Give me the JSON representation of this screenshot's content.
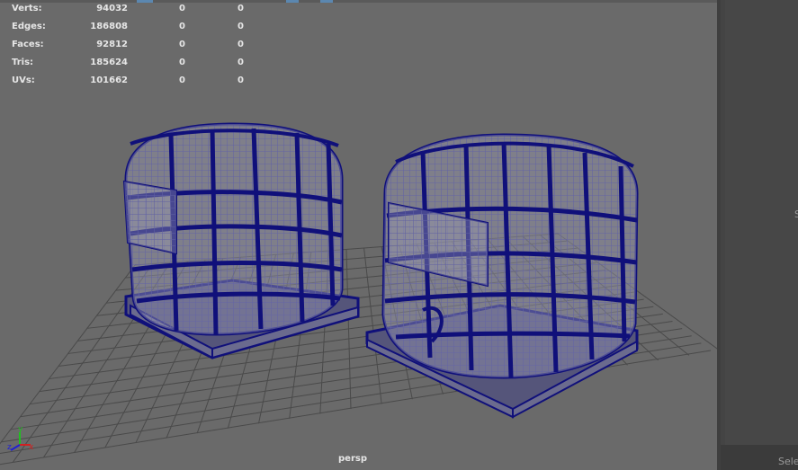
{
  "hud": {
    "rows": [
      {
        "label": "Verts:",
        "v1": "94032",
        "v2": "0",
        "v3": "0"
      },
      {
        "label": "Edges:",
        "v1": "186808",
        "v2": "0",
        "v3": "0"
      },
      {
        "label": "Faces:",
        "v1": "92812",
        "v2": "0",
        "v3": "0"
      },
      {
        "label": "Tris:",
        "v1": "185624",
        "v2": "0",
        "v3": "0"
      },
      {
        "label": "UVs:",
        "v1": "101662",
        "v2": "0",
        "v3": "0"
      }
    ]
  },
  "viewport": {
    "camera": "persp",
    "axis_labels": {
      "x": "x",
      "y": "y",
      "z": "z"
    }
  },
  "right_panel": {
    "footer_text": "Sele",
    "side_label": "S"
  },
  "colors": {
    "viewport_bg": "#6a6a6a",
    "grid": "#4a4a4a",
    "wire": "#10107a",
    "mesh_face": "#9a9ab2",
    "axis_x": "#d22020",
    "axis_y": "#20c020",
    "axis_z": "#2020d2"
  }
}
